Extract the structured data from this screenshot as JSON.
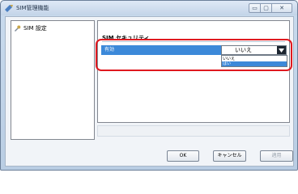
{
  "window": {
    "title": "SIM管理機能"
  },
  "caption_buttons": {
    "minimize": "▭",
    "maximize": "▢",
    "close": "✕"
  },
  "tree": {
    "items": [
      {
        "label": "SIM 設定",
        "icon": "wrench-icon"
      }
    ]
  },
  "panel": {
    "group_title": "SIM セキュリティ",
    "row": {
      "label": "有効",
      "value": "いいえ"
    },
    "dropdown_options": [
      "いいえ",
      "はい"
    ],
    "highlighted_option": "はい"
  },
  "buttons": {
    "ok": "OK",
    "cancel": "キャンセル",
    "apply": "適用"
  },
  "colors": {
    "selection": "#3c89d9",
    "annotation": "#e0191f"
  }
}
